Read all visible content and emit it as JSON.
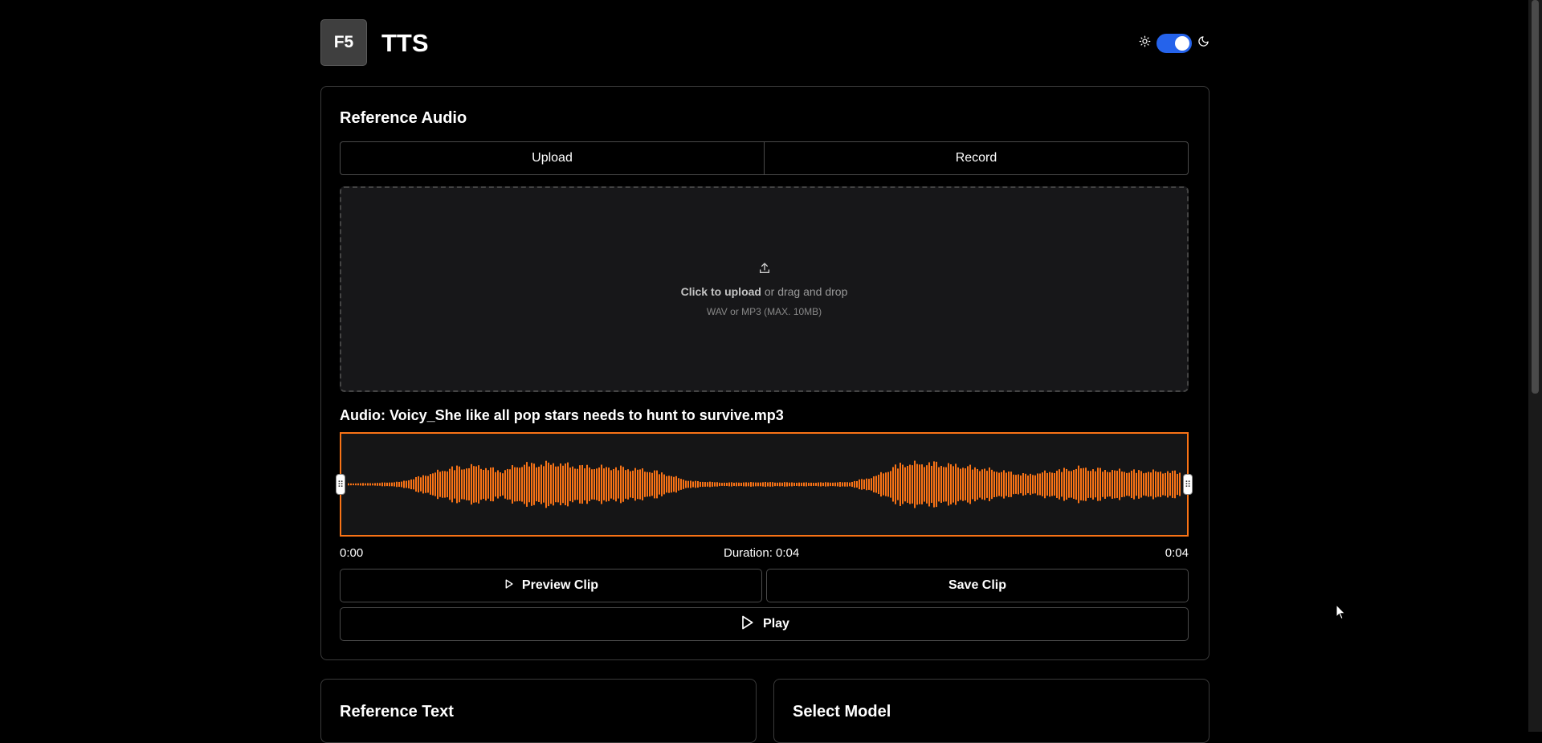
{
  "header": {
    "logo_text": "F5",
    "title": "TTS",
    "theme": {
      "sun_icon": "sun-icon",
      "moon_icon": "moon-icon",
      "dark_mode": true,
      "toggle_color": "#2563eb"
    }
  },
  "reference_audio": {
    "title": "Reference Audio",
    "tabs": [
      {
        "label": "Upload"
      },
      {
        "label": "Record"
      }
    ],
    "dropzone": {
      "icon": "upload-icon",
      "click_text": "Click to upload",
      "rest_text": " or drag and drop",
      "formats": "WAV or MP3 (MAX. 10MB)"
    },
    "audio_label": "Audio: Voicy_She like all pop stars needs to hunt to survive.mp3",
    "waveform": {
      "color": "#f97316",
      "selection_start": 0.0,
      "selection_end": 1.0
    },
    "time_start": "0:00",
    "duration": "Duration: 0:04",
    "time_end": "0:04",
    "preview_button": "Preview Clip",
    "save_button": "Save Clip",
    "play_button": "Play"
  },
  "reference_text": {
    "title": "Reference Text"
  },
  "select_model": {
    "title": "Select Model"
  }
}
